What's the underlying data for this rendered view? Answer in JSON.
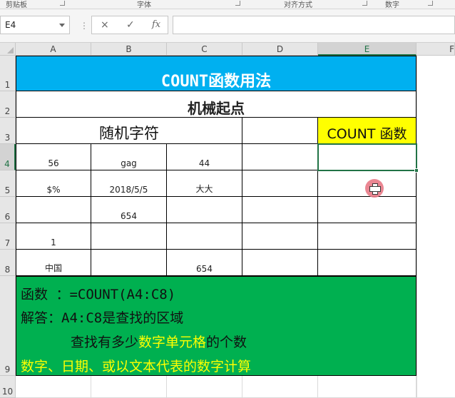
{
  "ribbon": {
    "groups": [
      "剪贴板",
      "字体",
      "对齐方式",
      "数字"
    ]
  },
  "formula_bar": {
    "name_box": "E4",
    "formula": "",
    "cancel_icon": "×",
    "enter_icon": "✓",
    "fx_icon": "fx"
  },
  "columns": [
    "A",
    "B",
    "C",
    "D",
    "E",
    "F"
  ],
  "rows": [
    "1",
    "2",
    "3",
    "4",
    "5",
    "6",
    "7",
    "8",
    "9",
    "10"
  ],
  "sheet": {
    "title": "COUNT函数用法",
    "subtitle": "机械起点",
    "random_header": "随机字符",
    "count_header": "COUNT 函数",
    "cells": {
      "A4": "56",
      "B4": "gag",
      "C4": "44",
      "A5": "$%",
      "B5": "2018/5/5",
      "C5": "大大",
      "B6": "654",
      "A7": "1",
      "A8": "中国",
      "C8": "654"
    },
    "note": {
      "line1": "函数 ：=COUNT(A4:C8)",
      "line2": "解答：A4:C8是查找的区域",
      "line3_prefix": "查找有多少",
      "line3_highlight": "数字单元格",
      "line3_suffix": "的个数",
      "line4": "数字、日期、或以文本代表的数字计算"
    }
  },
  "colors": {
    "title_bg": "#00b0f0",
    "header_yellow": "#ffff00",
    "note_green": "#00b050",
    "selection": "#217346"
  }
}
